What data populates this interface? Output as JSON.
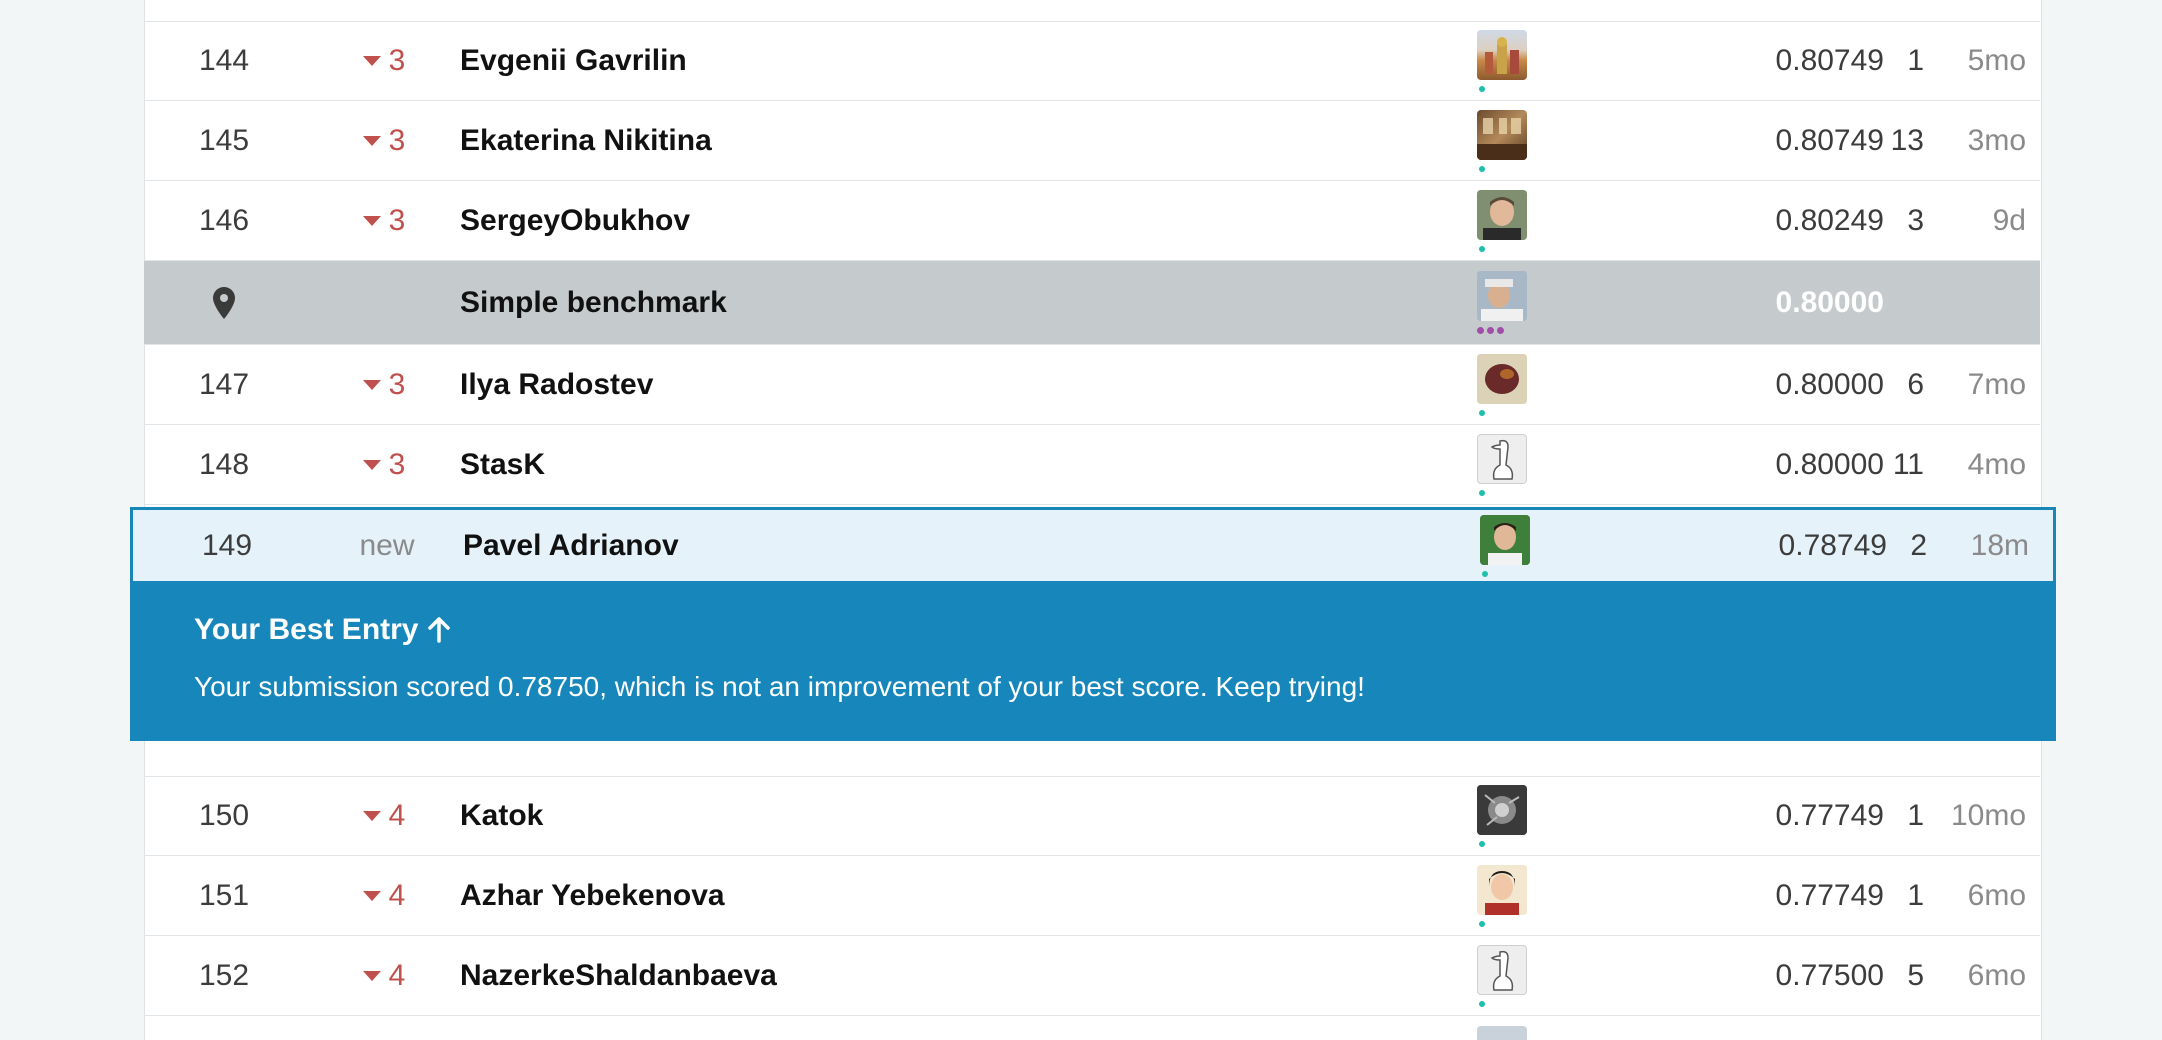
{
  "leaderboard": {
    "rows_above": [
      {
        "rank": "144",
        "change": "3",
        "name": "Evgenii Gavrilin",
        "score": "0.80749",
        "entries": "1",
        "last": "5mo",
        "avatar": "kremlin-photo"
      },
      {
        "rank": "145",
        "change": "3",
        "name": "Ekaterina Nikitina",
        "score": "0.80749",
        "entries": "13",
        "last": "3mo",
        "avatar": "interior-photo"
      },
      {
        "rank": "146",
        "change": "3",
        "name": "SergeyObukhov",
        "score": "0.80249",
        "entries": "3",
        "last": "9d",
        "avatar": "portrait-photo"
      }
    ],
    "benchmark": {
      "name": "Simple benchmark",
      "score": "0.80000",
      "icon": "map-pin-icon"
    },
    "rows_middle": [
      {
        "rank": "147",
        "change": "3",
        "name": "Ilya Radostev",
        "score": "0.80000",
        "entries": "6",
        "last": "7mo",
        "avatar": "food-photo"
      },
      {
        "rank": "148",
        "change": "3",
        "name": "StasK",
        "score": "0.80000",
        "entries": "11",
        "last": "4mo",
        "avatar": "goose-sketch"
      }
    ],
    "my_row": {
      "rank": "149",
      "change": "new",
      "name": "Pavel Adrianov",
      "score": "0.78749",
      "entries": "2",
      "last": "18m",
      "avatar": "portrait-green"
    },
    "banner": {
      "title": "Your Best Entry",
      "message": "Your submission scored 0.78750, which is not an improvement of your best score. Keep trying!"
    },
    "rows_below": [
      {
        "rank": "150",
        "change": "4",
        "name": "Katok",
        "score": "0.77749",
        "entries": "1",
        "last": "10mo",
        "avatar": "metal-photo"
      },
      {
        "rank": "151",
        "change": "4",
        "name": "Azhar Yebekenova",
        "score": "0.77749",
        "entries": "1",
        "last": "6mo",
        "avatar": "portrait-woman"
      },
      {
        "rank": "152",
        "change": "4",
        "name": "NazerkeShaldanbaeva",
        "score": "0.77500",
        "entries": "5",
        "last": "6mo",
        "avatar": "goose-sketch"
      }
    ]
  },
  "colors": {
    "accent": "#1787bb",
    "decline": "#c0504d",
    "benchmark_bg": "#c5cacd",
    "activity_dot": "#20beac"
  }
}
